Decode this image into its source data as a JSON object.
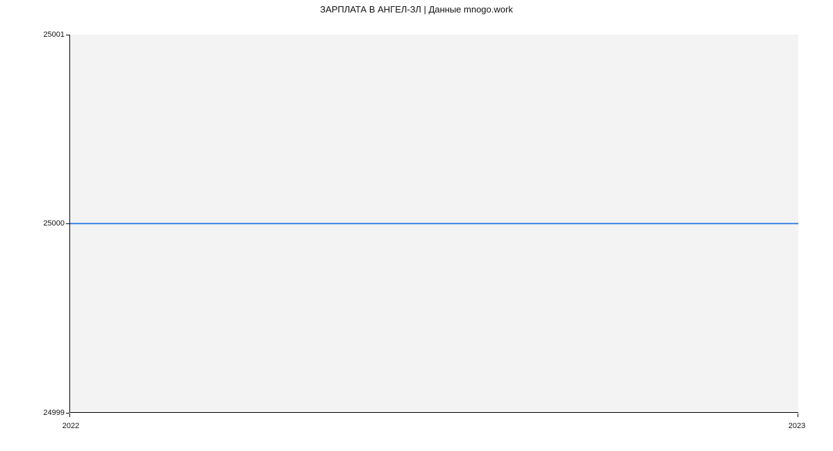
{
  "chart_data": {
    "type": "line",
    "title": "ЗАРПЛАТА В АНГЕЛ-ЗЛ | Данные mnogo.work",
    "x": [
      "2022",
      "2023"
    ],
    "values": [
      25000,
      25000
    ],
    "xlabel": "",
    "ylabel": "",
    "ylim": [
      24999,
      25001
    ],
    "y_ticks": [
      "24999",
      "25000",
      "25001"
    ],
    "x_ticks": [
      "2022",
      "2023"
    ],
    "line_color": "#3b82e6",
    "grid": false
  }
}
